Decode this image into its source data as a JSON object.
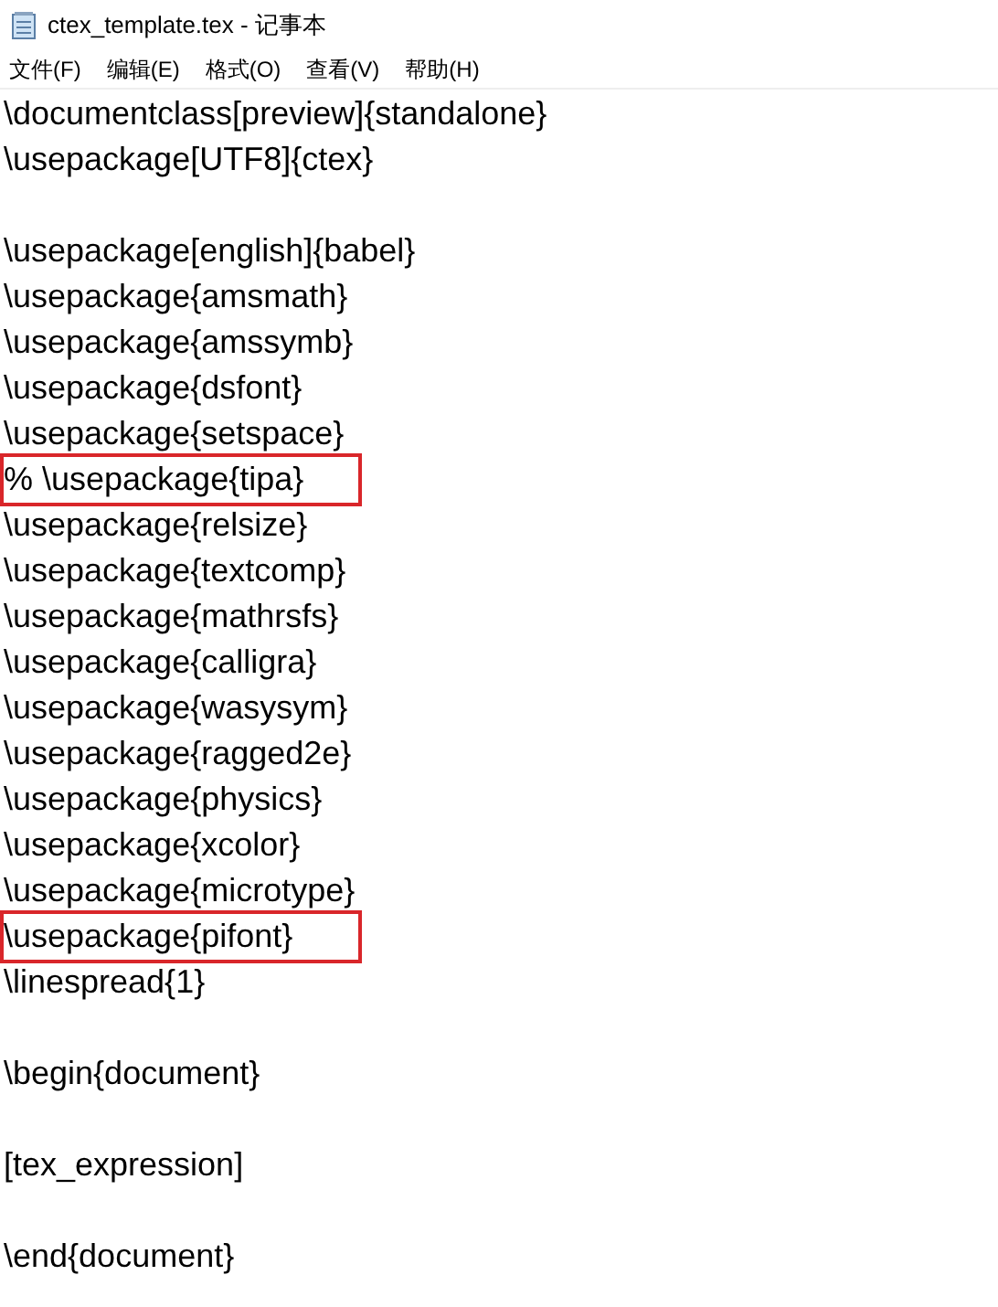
{
  "window": {
    "title": "ctex_template.tex - 记事本"
  },
  "menu": [
    "文件(F)",
    "编辑(E)",
    "格式(O)",
    "查看(V)",
    "帮助(H)"
  ],
  "lines": [
    {
      "kind": "text",
      "text": "\\documentclass[preview]{standalone}",
      "highlighted": false
    },
    {
      "kind": "text",
      "text": "\\usepackage[UTF8]{ctex}",
      "highlighted": false
    },
    {
      "kind": "blank"
    },
    {
      "kind": "text",
      "text": "\\usepackage[english]{babel}",
      "highlighted": false
    },
    {
      "kind": "text",
      "text": "\\usepackage{amsmath}",
      "highlighted": false
    },
    {
      "kind": "text",
      "text": "\\usepackage{amssymb}",
      "highlighted": false
    },
    {
      "kind": "text",
      "text": "\\usepackage{dsfont}",
      "highlighted": false
    },
    {
      "kind": "text",
      "text": "\\usepackage{setspace}",
      "highlighted": false
    },
    {
      "kind": "text",
      "text": "% \\usepackage{tipa}",
      "highlighted": true
    },
    {
      "kind": "text",
      "text": "\\usepackage{relsize}",
      "highlighted": false
    },
    {
      "kind": "text",
      "text": "\\usepackage{textcomp}",
      "highlighted": false
    },
    {
      "kind": "text",
      "text": "\\usepackage{mathrsfs}",
      "highlighted": false
    },
    {
      "kind": "text",
      "text": "\\usepackage{calligra}",
      "highlighted": false
    },
    {
      "kind": "text",
      "text": "\\usepackage{wasysym}",
      "highlighted": false
    },
    {
      "kind": "text",
      "text": "\\usepackage{ragged2e}",
      "highlighted": false
    },
    {
      "kind": "text",
      "text": "\\usepackage{physics}",
      "highlighted": false
    },
    {
      "kind": "text",
      "text": "\\usepackage{xcolor}",
      "highlighted": false
    },
    {
      "kind": "text",
      "text": "\\usepackage{microtype}",
      "highlighted": false
    },
    {
      "kind": "text",
      "text": "\\usepackage{pifont}",
      "highlighted": true
    },
    {
      "kind": "text",
      "text": "\\linespread{1}",
      "highlighted": false
    },
    {
      "kind": "blank"
    },
    {
      "kind": "text",
      "text": "\\begin{document}",
      "highlighted": false
    },
    {
      "kind": "blank"
    },
    {
      "kind": "text",
      "text": "[tex_expression]",
      "highlighted": false
    },
    {
      "kind": "blank"
    },
    {
      "kind": "text",
      "text": "\\end{document}",
      "highlighted": false
    }
  ]
}
